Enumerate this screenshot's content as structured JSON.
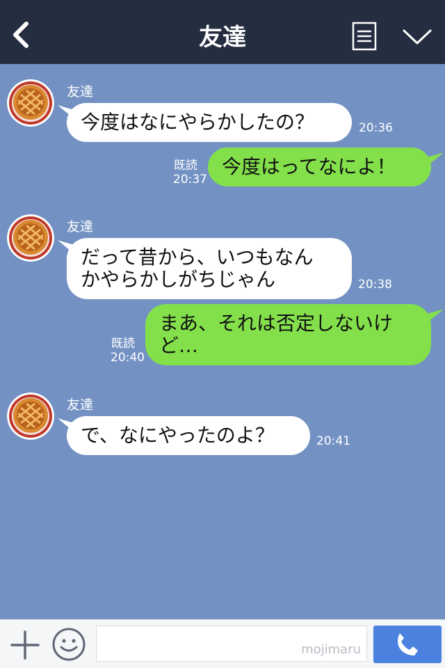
{
  "header": {
    "title": "友達"
  },
  "messages": [
    {
      "sender": "友達",
      "text": "今度はなにやらかしたの？",
      "time": "20:36"
    },
    {
      "text": "今度はってなによ！",
      "read": "既読",
      "time": "20:37"
    },
    {
      "sender": "友達",
      "text": "だって昔から、いつもなん\nかやらかしがちじゃん",
      "time": "20:38"
    },
    {
      "text": "まあ、それは否定しないけ\nど…",
      "read": "既読",
      "time": "20:40"
    },
    {
      "sender": "友達",
      "text": "で、なにやったのよ？",
      "time": "20:41"
    }
  ],
  "footer": {
    "watermark": "mojimaru"
  },
  "colors": {
    "header": "#252d40",
    "background": "#7392c3",
    "outgoing_bubble": "#83e04b",
    "incoming_bubble": "#ffffff",
    "send_button": "#4b82e0"
  },
  "icons": [
    "back-icon",
    "menu-icon",
    "chevron-down-icon",
    "avatar-pie-icon",
    "plus-icon",
    "smile-icon",
    "phone-icon"
  ]
}
